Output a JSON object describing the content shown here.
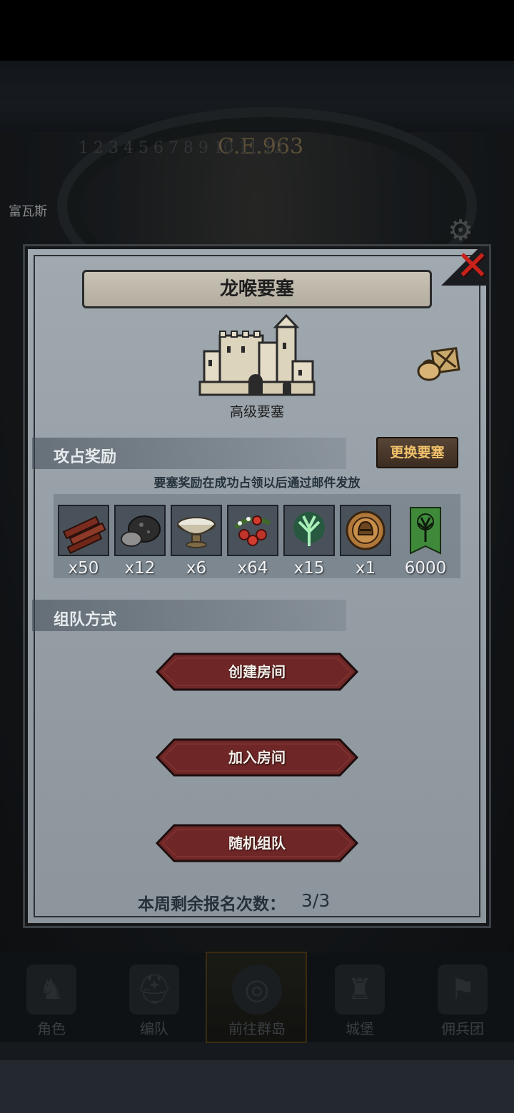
{
  "background": {
    "era": "C.E.963",
    "dial_numbers": "1 2 3 4 5 6 7 8 9 10 11 12",
    "location": "富瓦斯"
  },
  "modal": {
    "title": "龙喉要塞",
    "fortress_type": "高级要塞",
    "capture_reward": {
      "heading": "攻占奖励",
      "change_button": "更换要塞",
      "note": "要塞奖励在成功占领以后通过邮件发放",
      "items": [
        {
          "icon": "wood-icon",
          "qty": "x50"
        },
        {
          "icon": "ore-icon",
          "qty": "x12"
        },
        {
          "icon": "bowl-icon",
          "qty": "x6"
        },
        {
          "icon": "berries-icon",
          "qty": "x64"
        },
        {
          "icon": "green-tree-crystal-icon",
          "qty": "x15"
        },
        {
          "icon": "knight-medal-icon",
          "qty": "x1"
        },
        {
          "icon": "tree-banner-icon",
          "qty": "6000"
        }
      ]
    },
    "team_mode": {
      "heading": "组队方式",
      "buttons": [
        "创建房间",
        "加入房间",
        "随机组队"
      ]
    },
    "weekly_signups_label": "本周剩余报名次数：",
    "weekly_signups_value": "3/3",
    "close_symbol": "✕"
  },
  "navigation": {
    "items": [
      "角色",
      "编队",
      "前往群岛",
      "城堡",
      "佣兵团"
    ],
    "active": "前往群岛"
  },
  "colors": {
    "accent_gold": "#f1c26b",
    "close_red": "#c8221b",
    "button_red": "#6e2626",
    "panel_gray": "#959ea5"
  }
}
